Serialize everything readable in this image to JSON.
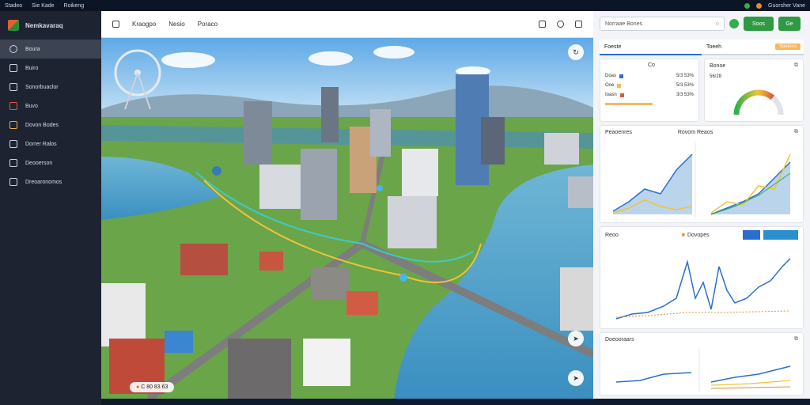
{
  "topbar": {
    "menu": [
      "Stadeo",
      "Sie Kade",
      "Roikeng"
    ],
    "user": "Guorsher Vane",
    "colors": {
      "green": "#2fb04a",
      "orange": "#e88a2a"
    }
  },
  "sidebar": {
    "brand": "Nemkavaraq",
    "items": [
      {
        "label": "Boura",
        "icon": "home-icon"
      },
      {
        "label": "Buiro",
        "icon": "clock-icon"
      },
      {
        "label": "Sonorbuaclor",
        "icon": "smile-icon"
      },
      {
        "label": "Buvo",
        "icon": "grid-icon"
      },
      {
        "label": "Dovon Bodes",
        "icon": "map-icon"
      },
      {
        "label": "Dorrer Ralos",
        "icon": "folder-icon"
      },
      {
        "label": "Deooerson",
        "icon": "refresh-icon"
      },
      {
        "label": "Dreoaronomos",
        "icon": "settings-icon"
      }
    ]
  },
  "main": {
    "toolbar": {
      "title": "Kraogpo",
      "tab1": "Nesio",
      "tab2": "Poraco"
    },
    "coords": "C 80 83 63"
  },
  "panel": {
    "search_value": "Norraae Bones",
    "btn1": "Soos",
    "btn2": "Ge",
    "tab_left": "Foeste",
    "tab_right": "Toeeh",
    "tab_badge": "Soeecrs",
    "summary": {
      "title": "Co",
      "rows": [
        {
          "label": "Doas",
          "color": "#2a6fcf",
          "value": "5/3 53%"
        },
        {
          "label": "Ooe",
          "color": "#f4b860",
          "value": "5/3 53%"
        },
        {
          "label": "Ioasn",
          "color": "#e05a3a",
          "value": "3/3 53%"
        }
      ],
      "gauge_title": "Bonoe",
      "gauge_value": "56/28",
      "gauge_level": 0.72
    },
    "chart1": {
      "title": "Peaoenres",
      "title2": "Rovom Reaos"
    },
    "chart2": {
      "title": "Reoo",
      "legend": "Dovopes"
    },
    "chart3": {
      "title": "Doeooraars"
    }
  }
}
